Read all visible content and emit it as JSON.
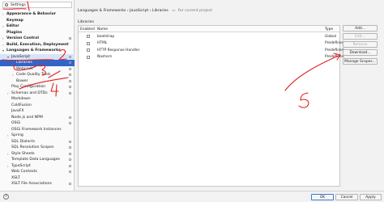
{
  "search": {
    "value": "Settings"
  },
  "tree": [
    {
      "label": "Appearance & Behavior",
      "indent": 0,
      "arrow": "right",
      "bold": true
    },
    {
      "label": "Keymap",
      "indent": 0,
      "arrow": "",
      "bold": true
    },
    {
      "label": "Editor",
      "indent": 0,
      "arrow": "right",
      "bold": true
    },
    {
      "label": "Plugins",
      "indent": 0,
      "arrow": "",
      "bold": true
    },
    {
      "label": "Version Control",
      "indent": 0,
      "arrow": "right",
      "bold": true,
      "gear": true
    },
    {
      "label": "Build, Execution, Deployment",
      "indent": 0,
      "arrow": "right",
      "bold": true
    },
    {
      "label": "Languages & Frameworks",
      "indent": 0,
      "arrow": "down",
      "bold": true
    },
    {
      "label": "JavaScript",
      "indent": 1,
      "arrow": "down",
      "bold": false,
      "gear": true,
      "hl": true
    },
    {
      "label": "Libraries",
      "indent": 2,
      "arrow": "",
      "bold": false,
      "gear": true,
      "selected": true
    },
    {
      "label": "Webpack",
      "indent": 2,
      "arrow": "",
      "bold": false,
      "gear": true
    },
    {
      "label": "Code Quality Tools",
      "indent": 2,
      "arrow": "right",
      "bold": false,
      "gear": true
    },
    {
      "label": "Bower",
      "indent": 2,
      "arrow": "",
      "bold": false,
      "gear": true
    },
    {
      "label": "Play Configuration",
      "indent": 1,
      "arrow": "",
      "bold": false,
      "gear": true
    },
    {
      "label": "Schemas and DTDs",
      "indent": 1,
      "arrow": "right",
      "bold": false,
      "gear": true
    },
    {
      "label": "Markdown",
      "indent": 1,
      "arrow": "",
      "bold": false
    },
    {
      "label": "ColdFusion",
      "indent": 1,
      "arrow": "",
      "bold": false
    },
    {
      "label": "JavaFX",
      "indent": 1,
      "arrow": "",
      "bold": false
    },
    {
      "label": "Node.js and NPM",
      "indent": 1,
      "arrow": "",
      "bold": false,
      "gear": true
    },
    {
      "label": "OSGi",
      "indent": 1,
      "arrow": "",
      "bold": false,
      "gear": true
    },
    {
      "label": "OSGi Framework Instances",
      "indent": 1,
      "arrow": "",
      "bold": false
    },
    {
      "label": "Spring",
      "indent": 1,
      "arrow": "right",
      "bold": false
    },
    {
      "label": "SQL Dialects",
      "indent": 1,
      "arrow": "",
      "bold": false,
      "gear": true
    },
    {
      "label": "SQL Resolution Scopes",
      "indent": 1,
      "arrow": "",
      "bold": false,
      "gear": true
    },
    {
      "label": "Style Sheets",
      "indent": 1,
      "arrow": "right",
      "bold": false,
      "gear": true
    },
    {
      "label": "Template Data Languages",
      "indent": 1,
      "arrow": "",
      "bold": false,
      "gear": true
    },
    {
      "label": "TypeScript",
      "indent": 1,
      "arrow": "right",
      "bold": false,
      "gear": true
    },
    {
      "label": "Web Contexts",
      "indent": 1,
      "arrow": "",
      "bold": false,
      "gear": true
    },
    {
      "label": "XSLT",
      "indent": 1,
      "arrow": "",
      "bold": false
    },
    {
      "label": "XSLT File Associations",
      "indent": 1,
      "arrow": "",
      "bold": false,
      "gear": true
    }
  ],
  "breadcrumb": {
    "path": "Languages & Frameworks › JavaScript › Libraries",
    "scope": "For current project"
  },
  "libraries_label": "Libraries",
  "table": {
    "headers": {
      "enabled": "Enabled",
      "name": "Name",
      "type": "Type"
    },
    "rows": [
      {
        "name": "bootstrap",
        "type": "Global"
      },
      {
        "name": "HTML",
        "type": "Predefined"
      },
      {
        "name": "HTTP Response Handler",
        "type": "Predefined"
      },
      {
        "name": "Nashorn",
        "type": "Predefined"
      }
    ]
  },
  "buttons": {
    "add": "Add...",
    "edit": "Edit...",
    "remove": "Remove",
    "download": "Download...",
    "manage": "Manage Scopes..."
  },
  "footer": {
    "help": "?",
    "ok": "OK",
    "cancel": "Cancel",
    "apply": "Apply"
  },
  "annotation_color": "#e02020"
}
